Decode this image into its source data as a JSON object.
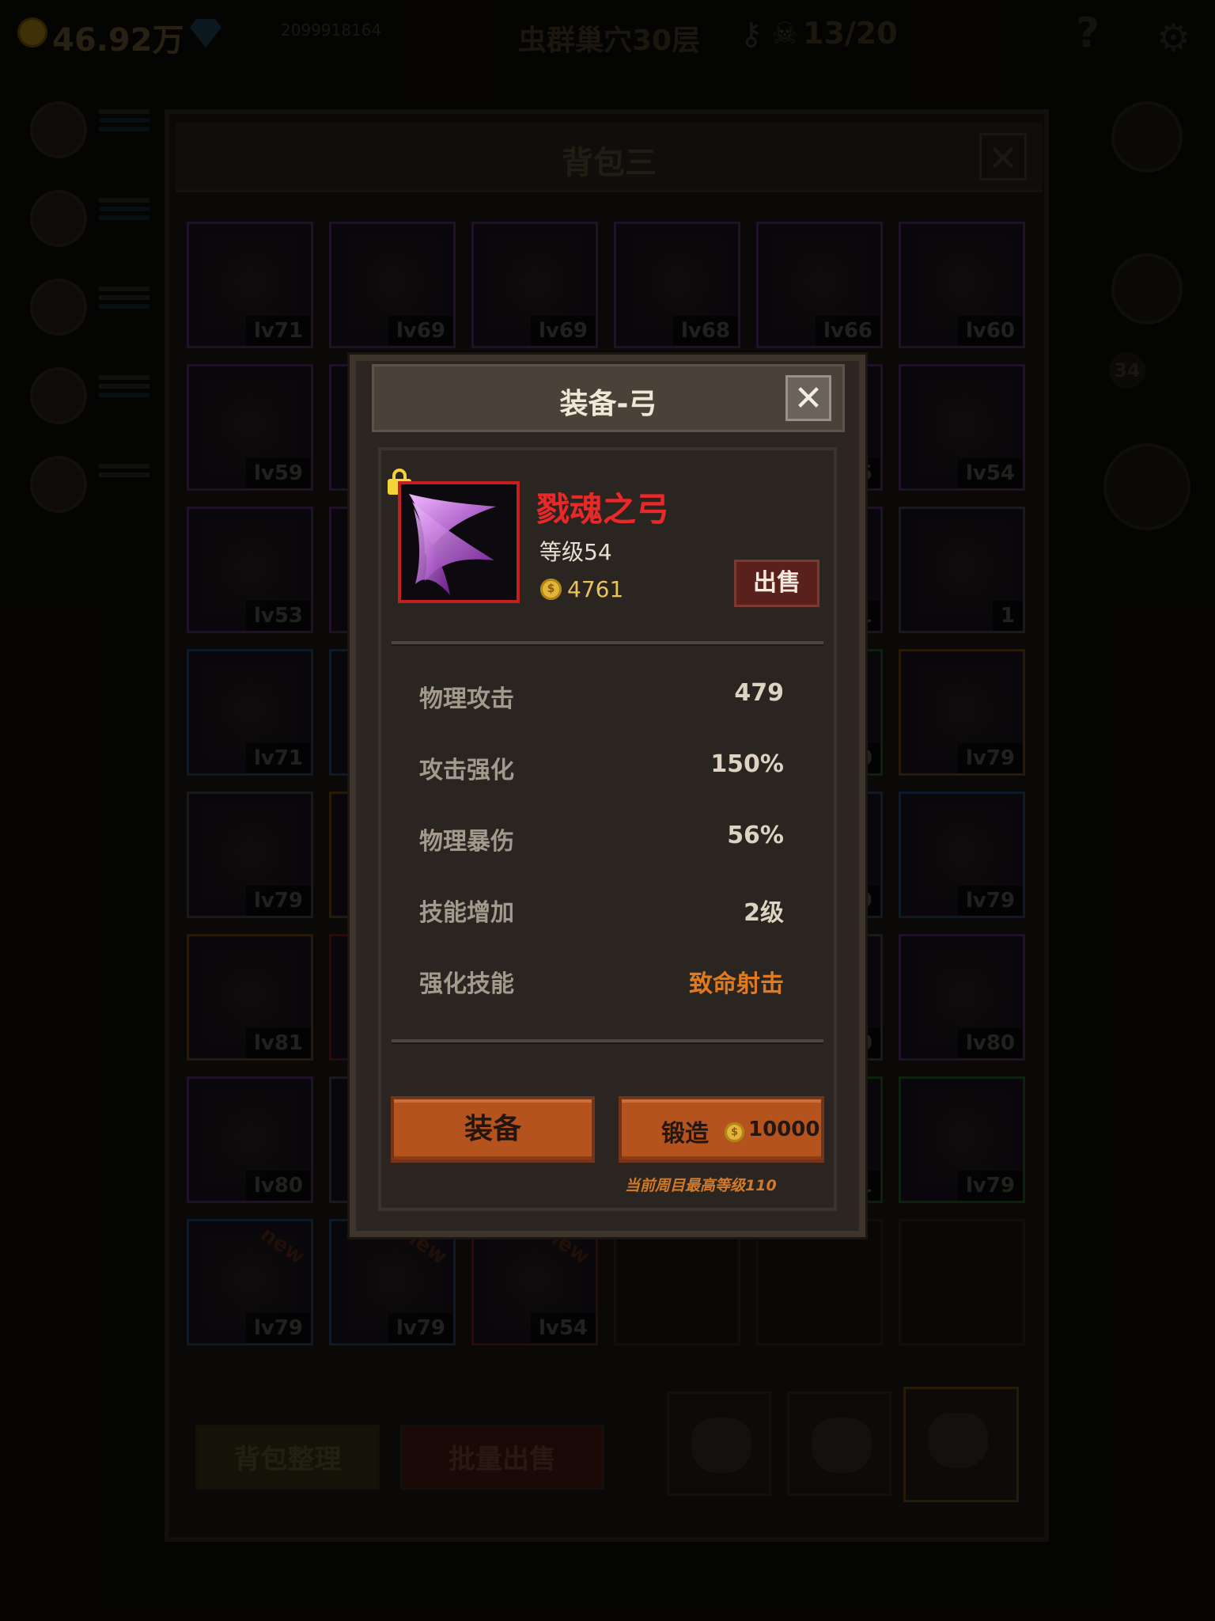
{
  "topbar": {
    "gold": "46.92万",
    "player_id": "2099918164",
    "floor": "虫群巢穴30层",
    "keys_count": "13/20",
    "help": "?"
  },
  "side_badge": "34",
  "bag": {
    "title": "背包三",
    "close": "✕",
    "tidy_label": "背包整理",
    "bulk_sell_label": "批量出售",
    "slots": [
      {
        "lv": "lv71",
        "rarity": "purple"
      },
      {
        "lv": "lv69",
        "rarity": "purple"
      },
      {
        "lv": "lv69",
        "rarity": "purple"
      },
      {
        "lv": "lv68",
        "rarity": "purple"
      },
      {
        "lv": "lv66",
        "rarity": "purple"
      },
      {
        "lv": "lv60",
        "rarity": "purple"
      },
      {
        "lv": "lv59",
        "rarity": "purple"
      },
      {
        "lv": "",
        "rarity": "purple"
      },
      {
        "lv": "",
        "rarity": "purple"
      },
      {
        "lv": "",
        "rarity": "purple"
      },
      {
        "lv": "5",
        "rarity": "purple"
      },
      {
        "lv": "lv54",
        "rarity": "purple"
      },
      {
        "lv": "lv53",
        "rarity": "purple"
      },
      {
        "lv": "",
        "rarity": "purple"
      },
      {
        "lv": "",
        "rarity": "purple"
      },
      {
        "lv": "",
        "rarity": "purple"
      },
      {
        "lv": "1",
        "rarity": "purple"
      },
      {
        "lv": "1",
        "rarity": "gray"
      },
      {
        "lv": "lv71",
        "rarity": "blue"
      },
      {
        "lv": "",
        "rarity": "blue"
      },
      {
        "lv": "",
        "rarity": "blue"
      },
      {
        "lv": "",
        "rarity": "blue"
      },
      {
        "lv": "0",
        "rarity": "green"
      },
      {
        "lv": "lv79",
        "rarity": "orange"
      },
      {
        "lv": "lv79",
        "rarity": "gray"
      },
      {
        "lv": "",
        "rarity": "orange"
      },
      {
        "lv": "",
        "rarity": "orange"
      },
      {
        "lv": "",
        "rarity": "orange"
      },
      {
        "lv": "9",
        "rarity": "blue"
      },
      {
        "lv": "lv79",
        "rarity": "blue"
      },
      {
        "lv": "lv81",
        "rarity": "orange"
      },
      {
        "lv": "",
        "rarity": "red"
      },
      {
        "lv": "",
        "rarity": "red"
      },
      {
        "lv": "",
        "rarity": "red"
      },
      {
        "lv": "0",
        "rarity": "gray"
      },
      {
        "lv": "lv80",
        "rarity": "purple"
      },
      {
        "lv": "lv80",
        "rarity": "purple"
      },
      {
        "lv": "",
        "rarity": "gray"
      },
      {
        "lv": "",
        "rarity": "gray"
      },
      {
        "lv": "",
        "rarity": "gray"
      },
      {
        "lv": "1",
        "rarity": "green"
      },
      {
        "lv": "lv79",
        "rarity": "green"
      },
      {
        "lv": "lv79",
        "rarity": "blue",
        "new": "new"
      },
      {
        "lv": "lv79",
        "rarity": "blue",
        "new": "new"
      },
      {
        "lv": "lv54",
        "rarity": "red",
        "new": "new"
      },
      {
        "lv": "",
        "rarity": "empty"
      },
      {
        "lv": "",
        "rarity": "empty"
      },
      {
        "lv": "",
        "rarity": "empty"
      }
    ]
  },
  "modal": {
    "title": "装备-弓",
    "close": "✕",
    "item_name": "戮魂之弓",
    "item_level": "等级54",
    "price": "4761",
    "sell_label": "出售",
    "stats": [
      {
        "label": "物理攻击",
        "value": "479"
      },
      {
        "label": "攻击强化",
        "value": "150%"
      },
      {
        "label": "物理暴伤",
        "value": "56%"
      },
      {
        "label": "技能增加",
        "value": "2级"
      },
      {
        "label": "强化技能",
        "value": "致命射击"
      }
    ],
    "equip_label": "装备",
    "forge_label": "锻造",
    "forge_cost": "10000",
    "max_level_note": "当前周目最高等级110",
    "coin_symbol": "$"
  },
  "colors": {
    "item_name": "#e8292a",
    "skill_value": "#df7a1e",
    "button_orange": "#b5531f",
    "rarity_frame": "#c41f1f"
  }
}
